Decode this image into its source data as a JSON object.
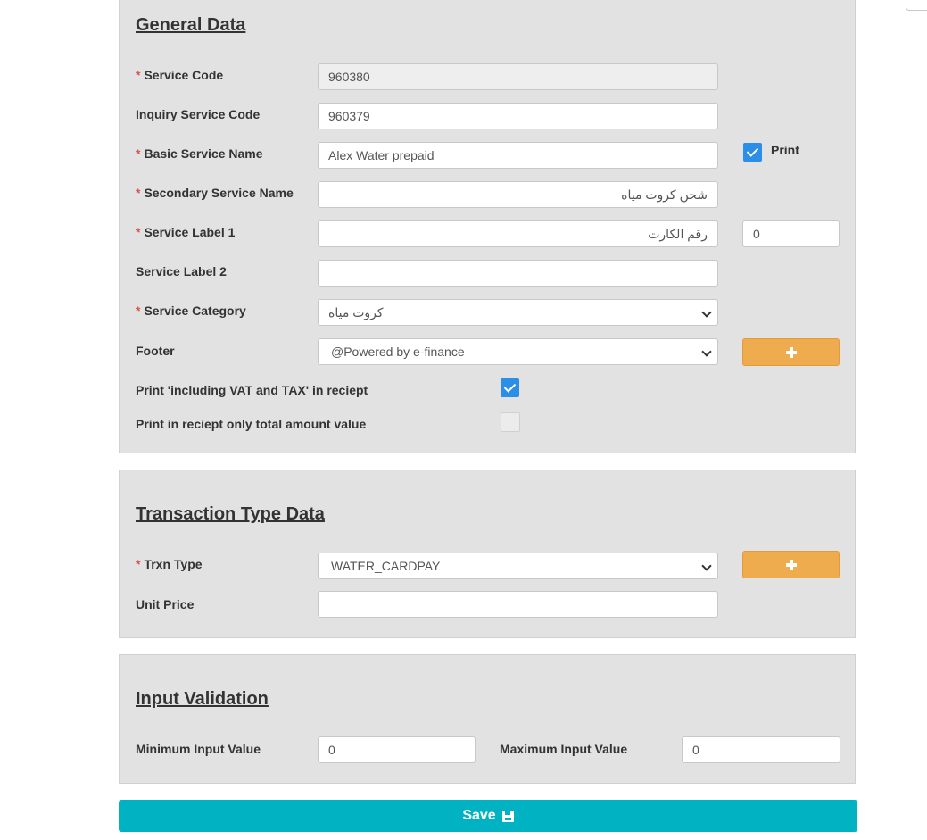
{
  "general": {
    "title": "General Data",
    "service_code": {
      "label": "Service Code",
      "value": "960380"
    },
    "inquiry_service_code": {
      "label": "Inquiry Service Code",
      "value": "960379"
    },
    "basic_service_name": {
      "label": "Basic Service Name",
      "value": "Alex Water prepaid",
      "print_label": "Print",
      "print_checked": true
    },
    "secondary_service_name": {
      "label": "Secondary Service Name",
      "value": "شحن كروت مياه"
    },
    "service_label_1": {
      "label": "Service Label 1",
      "value": "رقم الكارت",
      "number_value": "0"
    },
    "service_label_2": {
      "label": "Service Label 2",
      "value": ""
    },
    "service_category": {
      "label": "Service Category",
      "value": "كروت مياه"
    },
    "footer": {
      "label": "Footer",
      "value": "@Powered by e-finance"
    },
    "vat_tax": {
      "label": "Print 'including VAT and TAX' in reciept",
      "checked": true
    },
    "total_only": {
      "label": "Print in reciept only total amount value",
      "checked": false
    }
  },
  "transaction": {
    "title": "Transaction Type Data",
    "trxn_type": {
      "label": "Trxn Type",
      "value": "WATER_CARDPAY"
    },
    "unit_price": {
      "label": "Unit Price",
      "value": ""
    }
  },
  "validation": {
    "title": "Input Validation",
    "min": {
      "label": "Minimum Input Value",
      "value": "0"
    },
    "max": {
      "label": "Maximum Input Value",
      "value": "0"
    }
  },
  "save_label": "Save",
  "icons": {
    "add": "plus-icon",
    "save": "floppy-disk-icon",
    "dropdown": "chevron-down-icon",
    "checkbox": "check-icon"
  },
  "colors": {
    "required": "#d9534f",
    "checkbox": "#2b8fe8",
    "add_button": "#efac4f",
    "save_button": "#00b2c2",
    "panel": "#e2e2e2"
  }
}
